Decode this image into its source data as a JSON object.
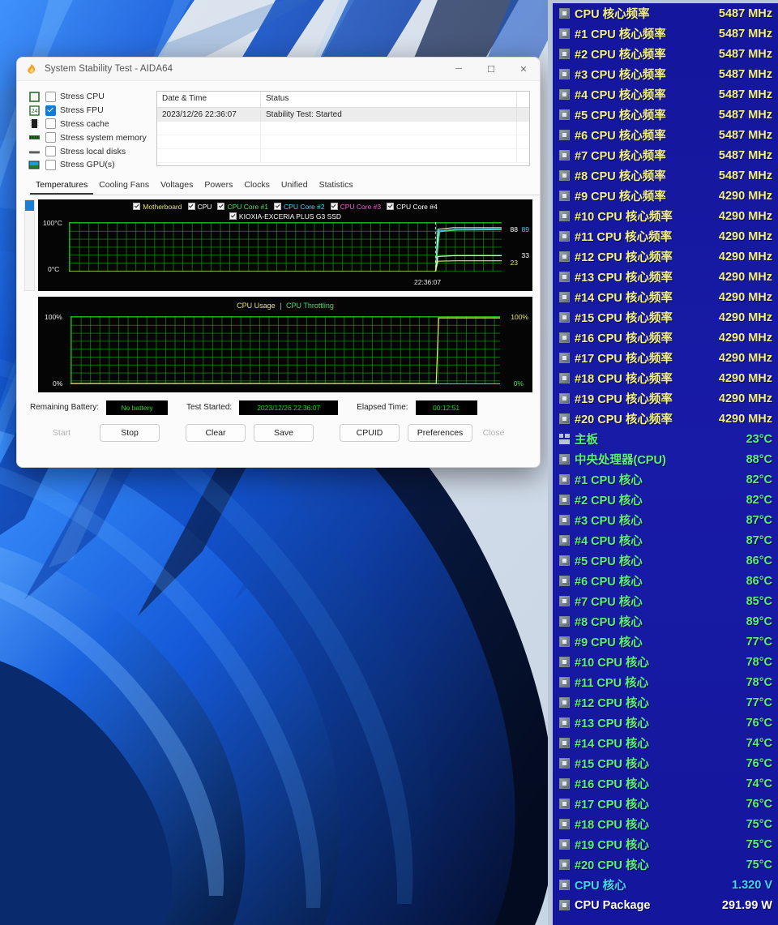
{
  "window": {
    "title": "System Stability Test - AIDA64",
    "app_icon": "aida64-flame-icon",
    "controls": {
      "minimize": "─",
      "maximize": "☐",
      "close": "✕"
    },
    "stress_options": [
      {
        "label": "Stress CPU",
        "checked": false,
        "icon": "cpu-icon"
      },
      {
        "label": "Stress FPU",
        "checked": true,
        "icon": "fpu-icon"
      },
      {
        "label": "Stress cache",
        "checked": false,
        "icon": "cache-icon"
      },
      {
        "label": "Stress system memory",
        "checked": false,
        "icon": "memory-icon"
      },
      {
        "label": "Stress local disks",
        "checked": false,
        "icon": "disk-icon"
      },
      {
        "label": "Stress GPU(s)",
        "checked": false,
        "icon": "gpu-icon"
      }
    ],
    "log": {
      "headers": [
        "Date & Time",
        "Status"
      ],
      "rows": [
        {
          "datetime": "2023/12/26 22:36:07",
          "status": "Stability Test: Started"
        }
      ]
    },
    "tabs": [
      {
        "label": "Temperatures",
        "active": true
      },
      {
        "label": "Cooling Fans",
        "active": false
      },
      {
        "label": "Voltages",
        "active": false
      },
      {
        "label": "Powers",
        "active": false
      },
      {
        "label": "Clocks",
        "active": false
      },
      {
        "label": "Unified",
        "active": false
      },
      {
        "label": "Statistics",
        "active": false
      }
    ],
    "temp_graph": {
      "legend_row1": [
        {
          "label": "Motherboard",
          "color": "#e8e46a",
          "checked": true
        },
        {
          "label": "CPU",
          "color": "#ffffff",
          "checked": true
        },
        {
          "label": "CPU Core #1",
          "color": "#45e06a",
          "checked": true
        },
        {
          "label": "CPU Core #2",
          "color": "#3fd8f5",
          "checked": true
        },
        {
          "label": "CPU Core #3",
          "color": "#ef5bd6",
          "checked": true
        },
        {
          "label": "CPU Core #4",
          "color": "#ffffff",
          "checked": true
        }
      ],
      "legend_row2": [
        {
          "label": "KIOXIA-EXCERIA PLUS G3 SSD",
          "color": "#ffffff",
          "checked": true
        }
      ],
      "y_top": "100°C",
      "y_bottom": "0°C",
      "x_mark": "22:36:07",
      "right_values": [
        {
          "text": "88",
          "color": "#ffffff"
        },
        {
          "text": "89",
          "color": "#3fd8f5"
        },
        {
          "text": "33",
          "color": "#ffffff"
        },
        {
          "text": "23",
          "color": "#e8e46a"
        }
      ]
    },
    "usage_graph": {
      "title_usage": "CPU Usage",
      "title_sep": "|",
      "title_throttling": "CPU Throttling",
      "y_top": "100%",
      "y_bottom": "0%",
      "right_top": "100%",
      "right_bottom": "0%"
    },
    "status": {
      "battery_label": "Remaining Battery:",
      "battery_value": "No battery",
      "started_label": "Test Started:",
      "started_value": "2023/12/26 22:36:07",
      "elapsed_label": "Elapsed Time:",
      "elapsed_value": "00:12:51"
    },
    "buttons": [
      {
        "label": "Start",
        "disabled": true
      },
      {
        "label": "Stop",
        "disabled": false
      },
      {
        "label": "Clear",
        "disabled": false
      },
      {
        "label": "Save",
        "disabled": false
      },
      {
        "label": "CPUID",
        "disabled": false
      },
      {
        "label": "Preferences",
        "disabled": false
      },
      {
        "label": "Close",
        "disabled": true
      }
    ]
  },
  "sensor_panel": {
    "colors": {
      "background": "#15179e",
      "frequency": "#f2ef86",
      "temperature": "#5bf07a",
      "voltage": "#3fd8f5",
      "power": "#ffffff"
    },
    "rows": [
      {
        "label": "CPU 核心频率",
        "value": "5487 MHz",
        "color": "c-yellow",
        "icon": "chip-icon"
      },
      {
        "label": "#1 CPU 核心频率",
        "value": "5487 MHz",
        "color": "c-yellow",
        "icon": "chip-icon"
      },
      {
        "label": "#2 CPU 核心频率",
        "value": "5487 MHz",
        "color": "c-yellow",
        "icon": "chip-icon"
      },
      {
        "label": "#3 CPU 核心频率",
        "value": "5487 MHz",
        "color": "c-yellow",
        "icon": "chip-icon"
      },
      {
        "label": "#4 CPU 核心频率",
        "value": "5487 MHz",
        "color": "c-yellow",
        "icon": "chip-icon"
      },
      {
        "label": "#5 CPU 核心频率",
        "value": "5487 MHz",
        "color": "c-yellow",
        "icon": "chip-icon"
      },
      {
        "label": "#6 CPU 核心频率",
        "value": "5487 MHz",
        "color": "c-yellow",
        "icon": "chip-icon"
      },
      {
        "label": "#7 CPU 核心频率",
        "value": "5487 MHz",
        "color": "c-yellow",
        "icon": "chip-icon"
      },
      {
        "label": "#8 CPU 核心频率",
        "value": "5487 MHz",
        "color": "c-yellow",
        "icon": "chip-icon"
      },
      {
        "label": "#9 CPU 核心频率",
        "value": "4290 MHz",
        "color": "c-yellow",
        "icon": "chip-icon"
      },
      {
        "label": "#10 CPU 核心频率",
        "value": "4290 MHz",
        "color": "c-yellow",
        "icon": "chip-icon"
      },
      {
        "label": "#11 CPU 核心频率",
        "value": "4290 MHz",
        "color": "c-yellow",
        "icon": "chip-icon"
      },
      {
        "label": "#12 CPU 核心频率",
        "value": "4290 MHz",
        "color": "c-yellow",
        "icon": "chip-icon"
      },
      {
        "label": "#13 CPU 核心频率",
        "value": "4290 MHz",
        "color": "c-yellow",
        "icon": "chip-icon"
      },
      {
        "label": "#14 CPU 核心频率",
        "value": "4290 MHz",
        "color": "c-yellow",
        "icon": "chip-icon"
      },
      {
        "label": "#15 CPU 核心频率",
        "value": "4290 MHz",
        "color": "c-yellow",
        "icon": "chip-icon"
      },
      {
        "label": "#16 CPU 核心频率",
        "value": "4290 MHz",
        "color": "c-yellow",
        "icon": "chip-icon"
      },
      {
        "label": "#17 CPU 核心频率",
        "value": "4290 MHz",
        "color": "c-yellow",
        "icon": "chip-icon"
      },
      {
        "label": "#18 CPU 核心频率",
        "value": "4290 MHz",
        "color": "c-yellow",
        "icon": "chip-icon"
      },
      {
        "label": "#19 CPU 核心频率",
        "value": "4290 MHz",
        "color": "c-yellow",
        "icon": "chip-icon"
      },
      {
        "label": "#20 CPU 核心频率",
        "value": "4290 MHz",
        "color": "c-yellow",
        "icon": "chip-icon"
      },
      {
        "label": "主板",
        "value": "23°C",
        "color": "c-green",
        "icon": "motherboard-icon"
      },
      {
        "label": "中央处理器(CPU)",
        "value": "88°C",
        "color": "c-green",
        "icon": "chip-icon"
      },
      {
        "label": "#1 CPU 核心",
        "value": "82°C",
        "color": "c-green",
        "icon": "chip-icon"
      },
      {
        "label": "#2 CPU 核心",
        "value": "82°C",
        "color": "c-green",
        "icon": "chip-icon"
      },
      {
        "label": "#3 CPU 核心",
        "value": "87°C",
        "color": "c-green",
        "icon": "chip-icon"
      },
      {
        "label": "#4 CPU 核心",
        "value": "87°C",
        "color": "c-green",
        "icon": "chip-icon"
      },
      {
        "label": "#5 CPU 核心",
        "value": "86°C",
        "color": "c-green",
        "icon": "chip-icon"
      },
      {
        "label": "#6 CPU 核心",
        "value": "86°C",
        "color": "c-green",
        "icon": "chip-icon"
      },
      {
        "label": "#7 CPU 核心",
        "value": "85°C",
        "color": "c-green",
        "icon": "chip-icon"
      },
      {
        "label": "#8 CPU 核心",
        "value": "89°C",
        "color": "c-green",
        "icon": "chip-icon"
      },
      {
        "label": "#9 CPU 核心",
        "value": "77°C",
        "color": "c-green",
        "icon": "chip-icon"
      },
      {
        "label": "#10 CPU 核心",
        "value": "78°C",
        "color": "c-green",
        "icon": "chip-icon"
      },
      {
        "label": "#11 CPU 核心",
        "value": "78°C",
        "color": "c-green",
        "icon": "chip-icon"
      },
      {
        "label": "#12 CPU 核心",
        "value": "77°C",
        "color": "c-green",
        "icon": "chip-icon"
      },
      {
        "label": "#13 CPU 核心",
        "value": "76°C",
        "color": "c-green",
        "icon": "chip-icon"
      },
      {
        "label": "#14 CPU 核心",
        "value": "74°C",
        "color": "c-green",
        "icon": "chip-icon"
      },
      {
        "label": "#15 CPU 核心",
        "value": "76°C",
        "color": "c-green",
        "icon": "chip-icon"
      },
      {
        "label": "#16 CPU 核心",
        "value": "74°C",
        "color": "c-green",
        "icon": "chip-icon"
      },
      {
        "label": "#17 CPU 核心",
        "value": "76°C",
        "color": "c-green",
        "icon": "chip-icon"
      },
      {
        "label": "#18 CPU 核心",
        "value": "75°C",
        "color": "c-green",
        "icon": "chip-icon"
      },
      {
        "label": "#19 CPU 核心",
        "value": "75°C",
        "color": "c-green",
        "icon": "chip-icon"
      },
      {
        "label": "#20 CPU 核心",
        "value": "75°C",
        "color": "c-green",
        "icon": "chip-icon"
      },
      {
        "label": "CPU 核心",
        "value": "1.320 V",
        "color": "c-cyan",
        "icon": "chip-icon"
      },
      {
        "label": "CPU Package",
        "value": "291.99 W",
        "color": "c-white",
        "icon": "chip-icon"
      }
    ]
  }
}
